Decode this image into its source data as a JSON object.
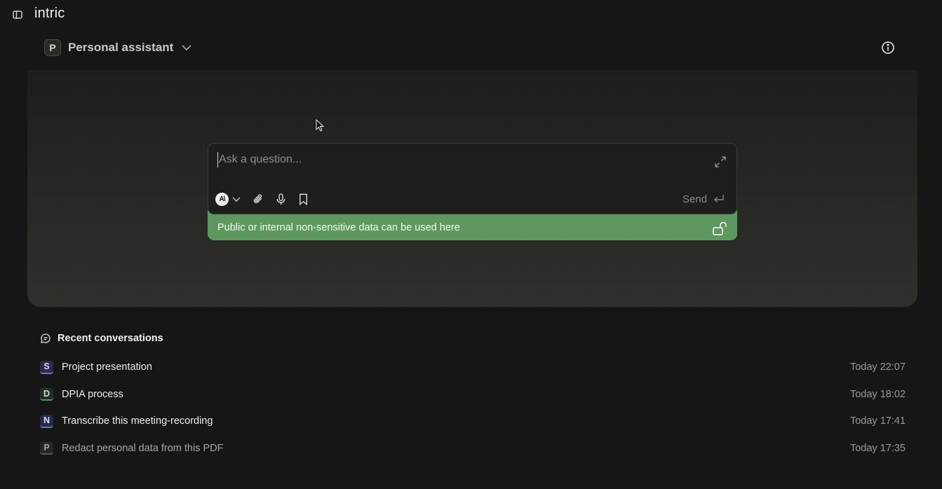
{
  "app": {
    "logo_text": "intric"
  },
  "assistant": {
    "avatar_letter": "P",
    "name": "Personal assistant"
  },
  "composer": {
    "placeholder": "Ask a question...",
    "value": "",
    "model_icon_text": "A\\",
    "send_label": "Send"
  },
  "security": {
    "text": "Public or internal non-sensitive data can be used here",
    "color": "#5e9760"
  },
  "recent": {
    "title": "Recent conversations",
    "items": [
      {
        "avatar": "S",
        "title": "Project presentation",
        "time": "Today 22:07"
      },
      {
        "avatar": "D",
        "title": "DPIA process",
        "time": "Today 18:02"
      },
      {
        "avatar": "N",
        "title": "Transcribe this meeting-recording",
        "time": "Today 17:41"
      },
      {
        "avatar": "P",
        "title": "Redact personal data from this PDF",
        "time": "Today 17:35"
      }
    ]
  },
  "icons": {
    "sidebar_toggle": "sidebar-toggle-icon",
    "info": "info-icon",
    "expand": "expand-icon",
    "attach": "paperclip-icon",
    "mic": "microphone-icon",
    "bookmark": "bookmark-icon",
    "send": "enter-icon",
    "lock": "unlock-icon",
    "chat": "chat-bubble-icon"
  }
}
